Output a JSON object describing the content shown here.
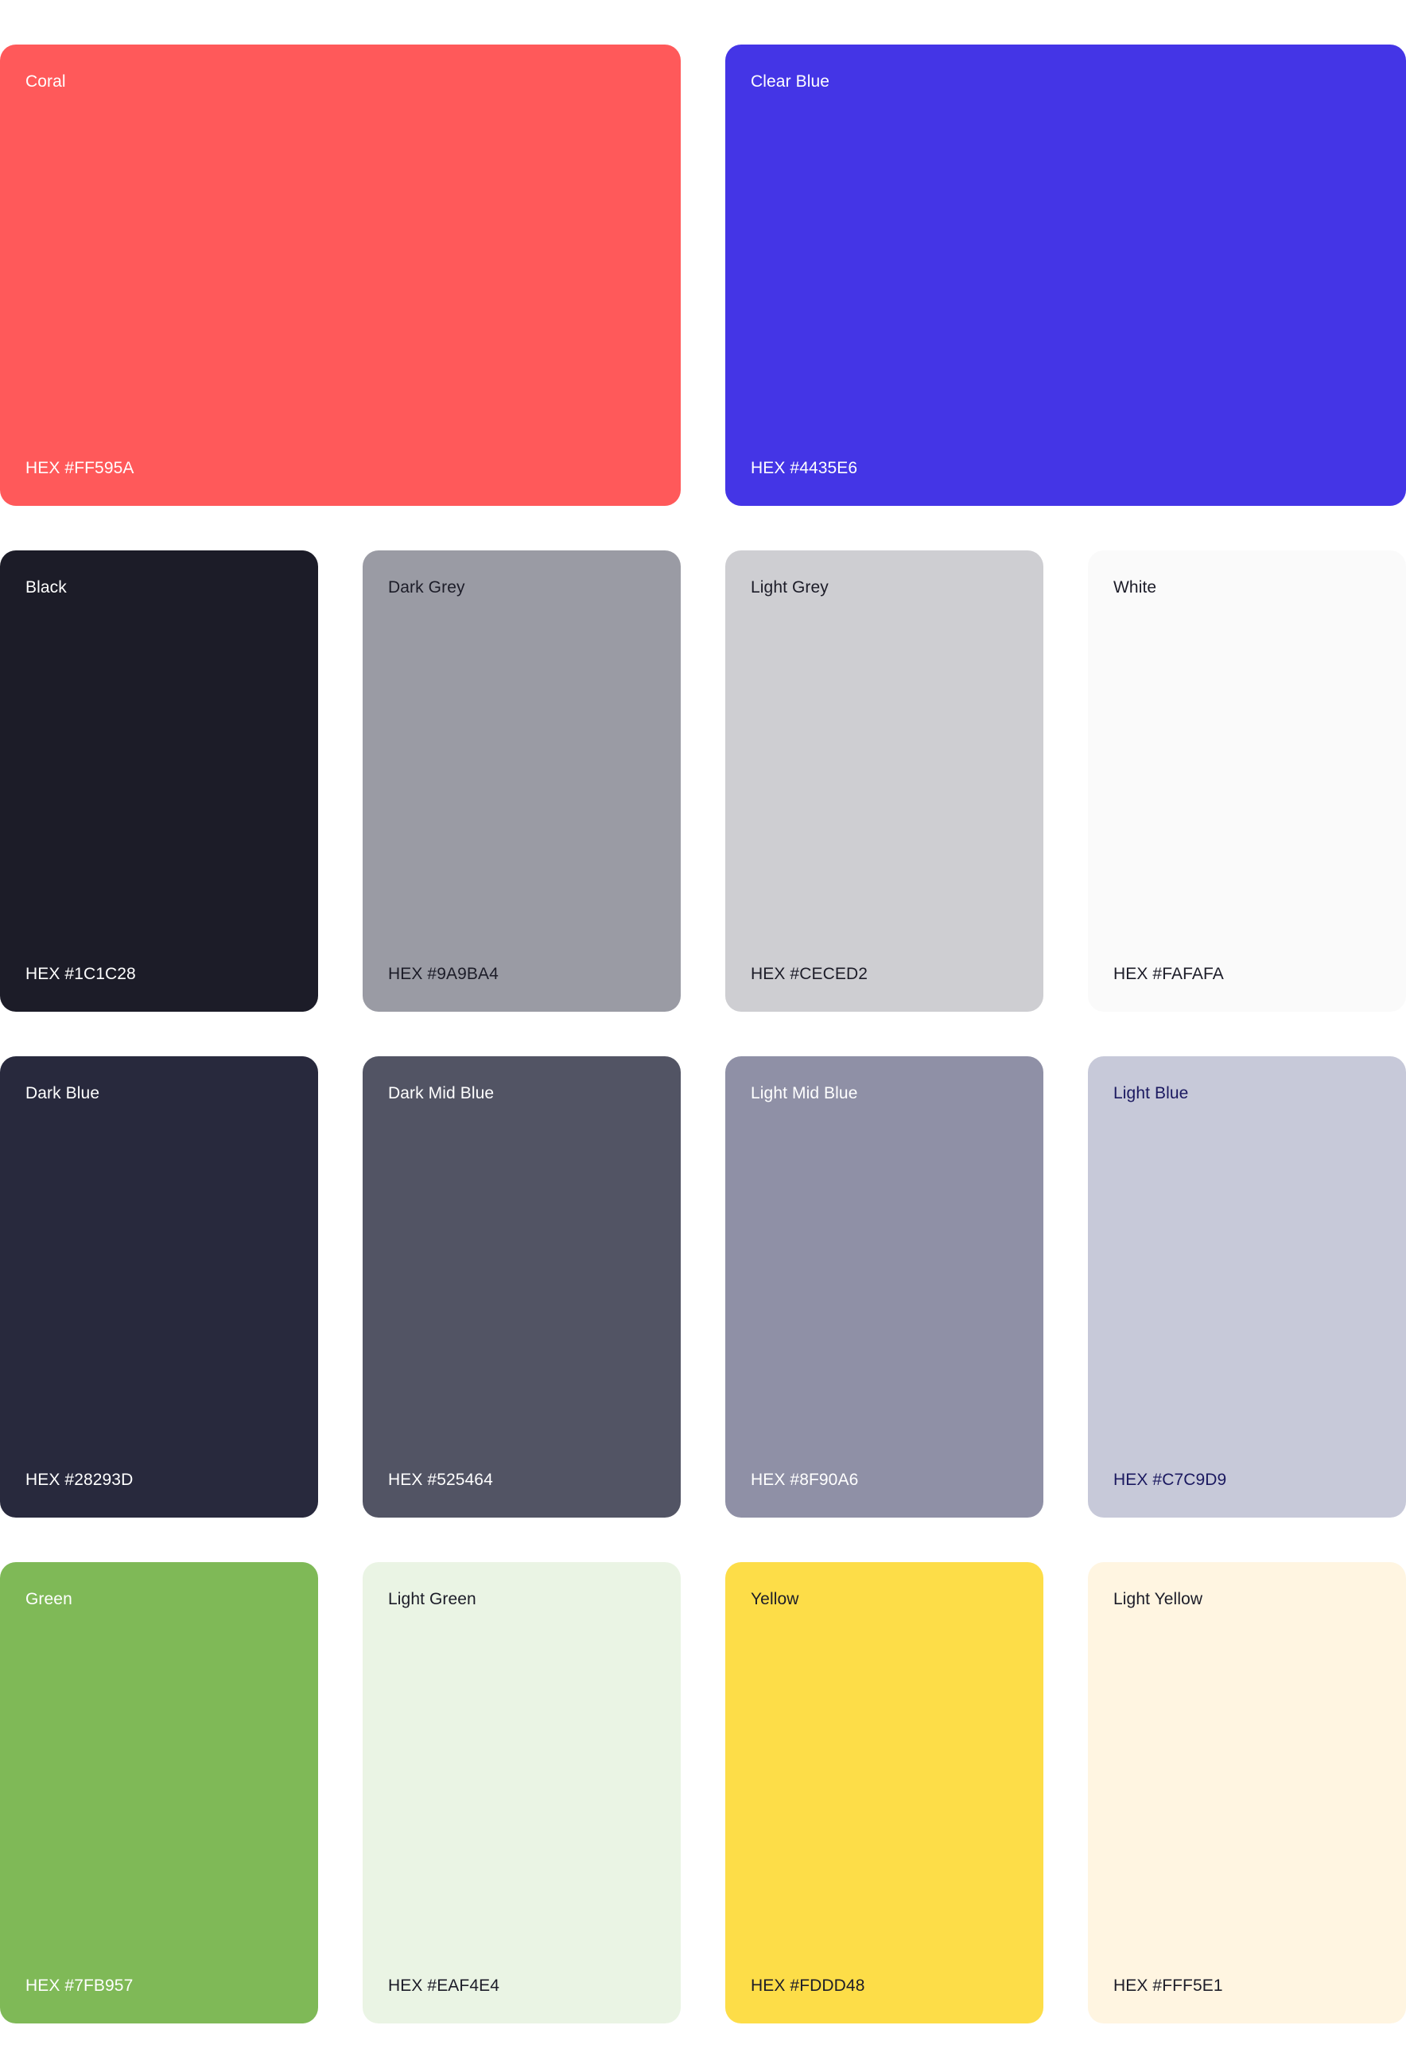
{
  "rows": [
    [
      {
        "name": "Coral",
        "hex_label": "HEX #FF595A",
        "color": "#FF595A",
        "text_color": "#FFFFFF"
      },
      {
        "name": "Clear Blue",
        "hex_label": "HEX #4435E6",
        "color": "#4435E6",
        "text_color": "#FFFFFF"
      }
    ],
    [
      {
        "name": "Black",
        "hex_label": "HEX #1C1C28",
        "color": "#1C1C28",
        "text_color": "#FFFFFF"
      },
      {
        "name": "Dark Grey",
        "hex_label": "HEX #9A9BA4",
        "color": "#9A9BA4",
        "text_color": "#1C1C28"
      },
      {
        "name": "Light Grey",
        "hex_label": "HEX #CECED2",
        "color": "#CECED2",
        "text_color": "#1C1C28"
      },
      {
        "name": "White",
        "hex_label": "HEX #FAFAFA",
        "color": "#FAFAFA",
        "text_color": "#1C1C28"
      }
    ],
    [
      {
        "name": "Dark Blue",
        "hex_label": "HEX #28293D",
        "color": "#28293D",
        "text_color": "#FFFFFF"
      },
      {
        "name": "Dark Mid Blue",
        "hex_label": "HEX #525464",
        "color": "#525464",
        "text_color": "#FFFFFF"
      },
      {
        "name": "Light Mid Blue",
        "hex_label": "HEX #8F90A6",
        "color": "#8F90A6",
        "text_color": "#FFFFFF"
      },
      {
        "name": "Light Blue",
        "hex_label": "HEX #C7C9D9",
        "color": "#C7C9D9",
        "text_color": "#1B1960"
      }
    ],
    [
      {
        "name": "Green",
        "hex_label": "HEX #7FB957",
        "color": "#7FB957",
        "text_color": "#FFFFFF"
      },
      {
        "name": "Light Green",
        "hex_label": "HEX #EAF4E4",
        "color": "#EAF4E4",
        "text_color": "#1C1C28"
      },
      {
        "name": "Yellow",
        "hex_label": "HEX #FDDD48",
        "color": "#FDDD48",
        "text_color": "#1C1C28"
      },
      {
        "name": "Light Yellow",
        "hex_label": "HEX #FFF5E1",
        "color": "#FFF5E1",
        "text_color": "#1C1C28"
      }
    ]
  ]
}
